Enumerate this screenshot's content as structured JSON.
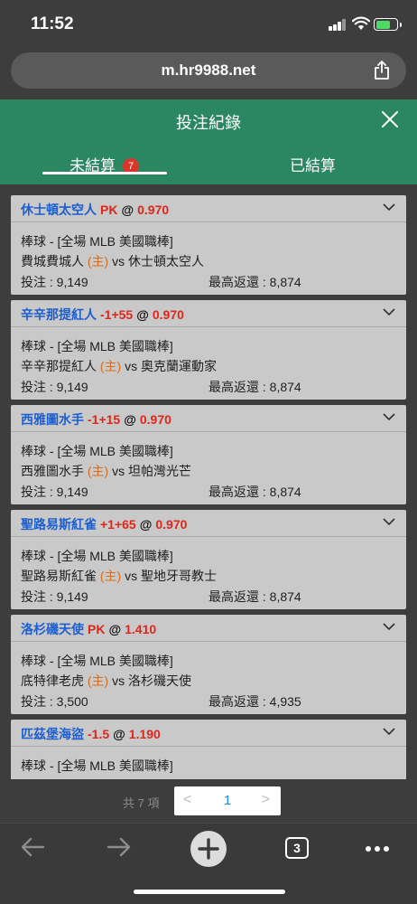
{
  "status": {
    "time": "11:52"
  },
  "browser": {
    "url": "m.hr9988.net",
    "tab_count": "3"
  },
  "header": {
    "title": "投注紀錄"
  },
  "tabs": [
    {
      "label": "未結算",
      "badge": "7"
    },
    {
      "label": "已結算"
    }
  ],
  "bets": [
    {
      "team": "休士頓太空人",
      "handicap": "PK",
      "at": "@",
      "odds": "0.970",
      "sport": "棒球 - [全場 MLB 美國職棒]",
      "home": "費城費城人",
      "home_tag": "(主)",
      "vs": "vs",
      "away": "休士頓太空人",
      "stake_label": "投注 : 9,149",
      "return_label": "最高返還 : 8,874"
    },
    {
      "team": "辛辛那提紅人",
      "handicap": "-1+55",
      "at": "@",
      "odds": "0.970",
      "sport": "棒球 - [全場 MLB 美國職棒]",
      "home": "辛辛那提紅人",
      "home_tag": "(主)",
      "vs": "vs",
      "away": "奧克蘭運動家",
      "stake_label": "投注 : 9,149",
      "return_label": "最高返還 : 8,874"
    },
    {
      "team": "西雅圖水手",
      "handicap": "-1+15",
      "at": "@",
      "odds": "0.970",
      "sport": "棒球 - [全場 MLB 美國職棒]",
      "home": "西雅圖水手",
      "home_tag": "(主)",
      "vs": "vs",
      "away": "坦帕灣光芒",
      "stake_label": "投注 : 9,149",
      "return_label": "最高返還 : 8,874"
    },
    {
      "team": "聖路易斯紅雀",
      "handicap": "+1+65",
      "at": "@",
      "odds": "0.970",
      "sport": "棒球 - [全場 MLB 美國職棒]",
      "home": "聖路易斯紅雀",
      "home_tag": "(主)",
      "vs": "vs",
      "away": "聖地牙哥教士",
      "stake_label": "投注 : 9,149",
      "return_label": "最高返還 : 8,874"
    },
    {
      "team": "洛杉磯天使",
      "handicap": "PK",
      "at": "@",
      "odds": "1.410",
      "sport": "棒球 - [全場 MLB 美國職棒]",
      "home": "底特律老虎",
      "home_tag": "(主)",
      "vs": "vs",
      "away": "洛杉磯天使",
      "stake_label": "投注 : 3,500",
      "return_label": "最高返還 : 4,935"
    },
    {
      "team": "匹茲堡海盜",
      "handicap": "-1.5",
      "at": "@",
      "odds": "1.190",
      "sport": "棒球 - [全場 MLB 美國職棒]",
      "home": "",
      "home_tag": "",
      "vs": "",
      "away": "",
      "stake_label": "",
      "return_label": ""
    }
  ],
  "pagination": {
    "total": "共 7 項",
    "prev": "<",
    "page": "1",
    "next": ">"
  },
  "colors": {
    "header_green": "#2b8662",
    "team_blue": "#1d5fd1",
    "odds_red": "#e0261b",
    "home_orange": "#d96d1a",
    "badge_red": "#d9352b"
  },
  "icons": [
    "close-icon",
    "share-icon",
    "chevron-down-icon",
    "back-icon",
    "forward-icon",
    "new-tab-icon",
    "tabs-icon",
    "more-icon"
  ]
}
